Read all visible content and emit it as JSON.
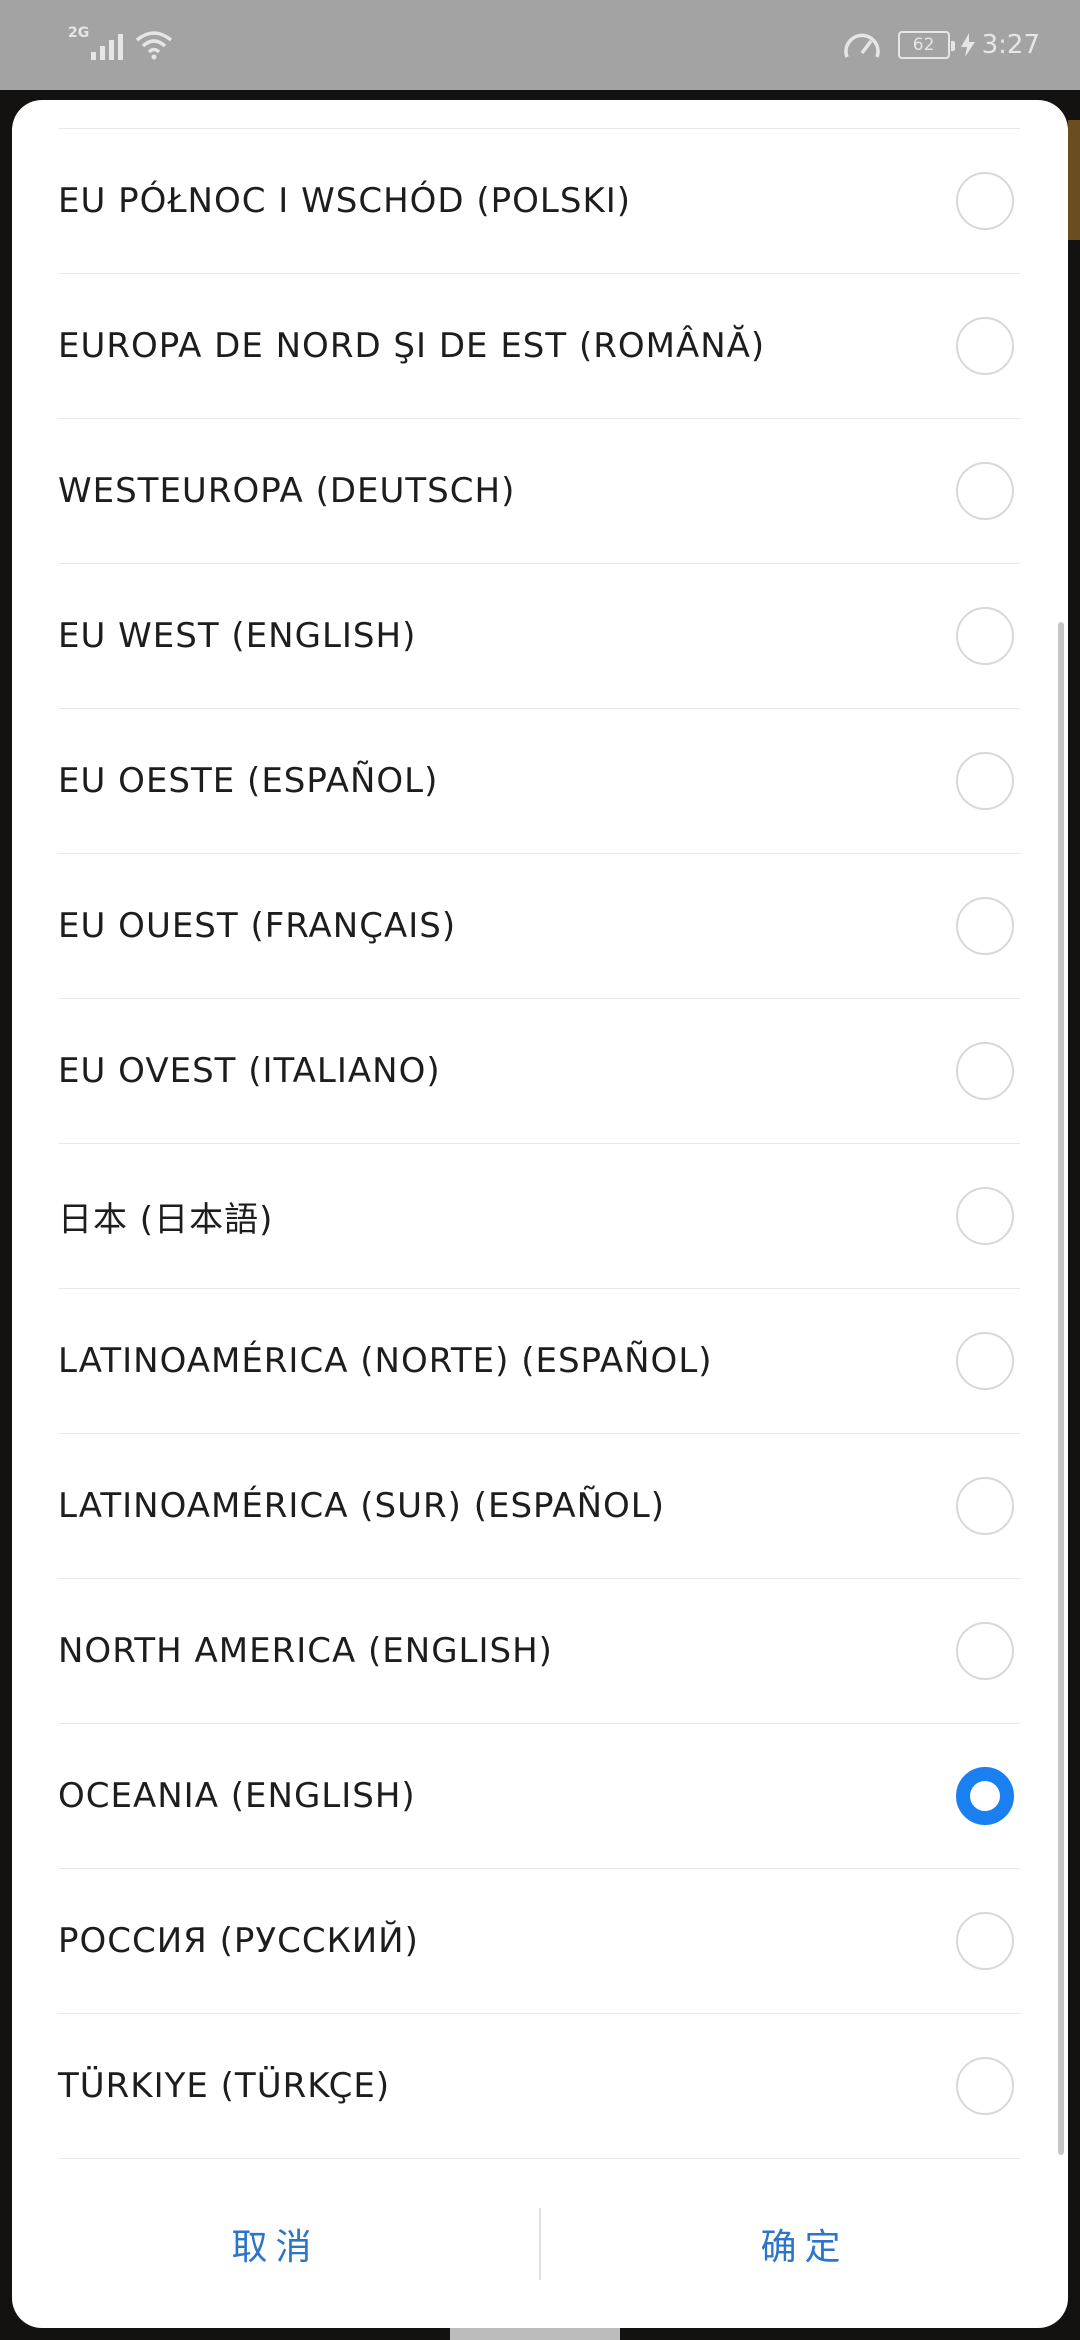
{
  "status_bar": {
    "network": "2G",
    "battery_percent": "62",
    "time": "3:27",
    "colors": {
      "bar": "#a3a3a3",
      "icons": "#e6e6e6"
    }
  },
  "dialog": {
    "items": [
      {
        "label": "EU PÓŁNOC I WSCHÓD (POLSKI)",
        "selected": false
      },
      {
        "label": "EUROPA DE NORD ŞI DE EST (ROMÂNĂ)",
        "selected": false
      },
      {
        "label": "WESTEUROPA (DEUTSCH)",
        "selected": false
      },
      {
        "label": "EU WEST (ENGLISH)",
        "selected": false
      },
      {
        "label": "EU OESTE (ESPAÑOL)",
        "selected": false
      },
      {
        "label": "EU OUEST (FRANÇAIS)",
        "selected": false
      },
      {
        "label": "EU OVEST (ITALIANO)",
        "selected": false
      },
      {
        "label": "日本 (日本語)",
        "selected": false
      },
      {
        "label": "LATINOAMÉRICA (NORTE) (ESPAÑOL)",
        "selected": false
      },
      {
        "label": "LATINOAMÉRICA (SUR) (ESPAÑOL)",
        "selected": false
      },
      {
        "label": "NORTH AMERICA (ENGLISH)",
        "selected": false
      },
      {
        "label": "OCEANIA (ENGLISH)",
        "selected": true
      },
      {
        "label": "РОССИЯ (РУССКИЙ)",
        "selected": false
      },
      {
        "label": "TÜRKIYE (TÜRKÇE)",
        "selected": false
      }
    ],
    "cancel_label": "取消",
    "confirm_label": "确定",
    "colors": {
      "accent": "#1a7ff0",
      "button_text": "#2b76c9",
      "divider": "#e8e8e8"
    }
  }
}
